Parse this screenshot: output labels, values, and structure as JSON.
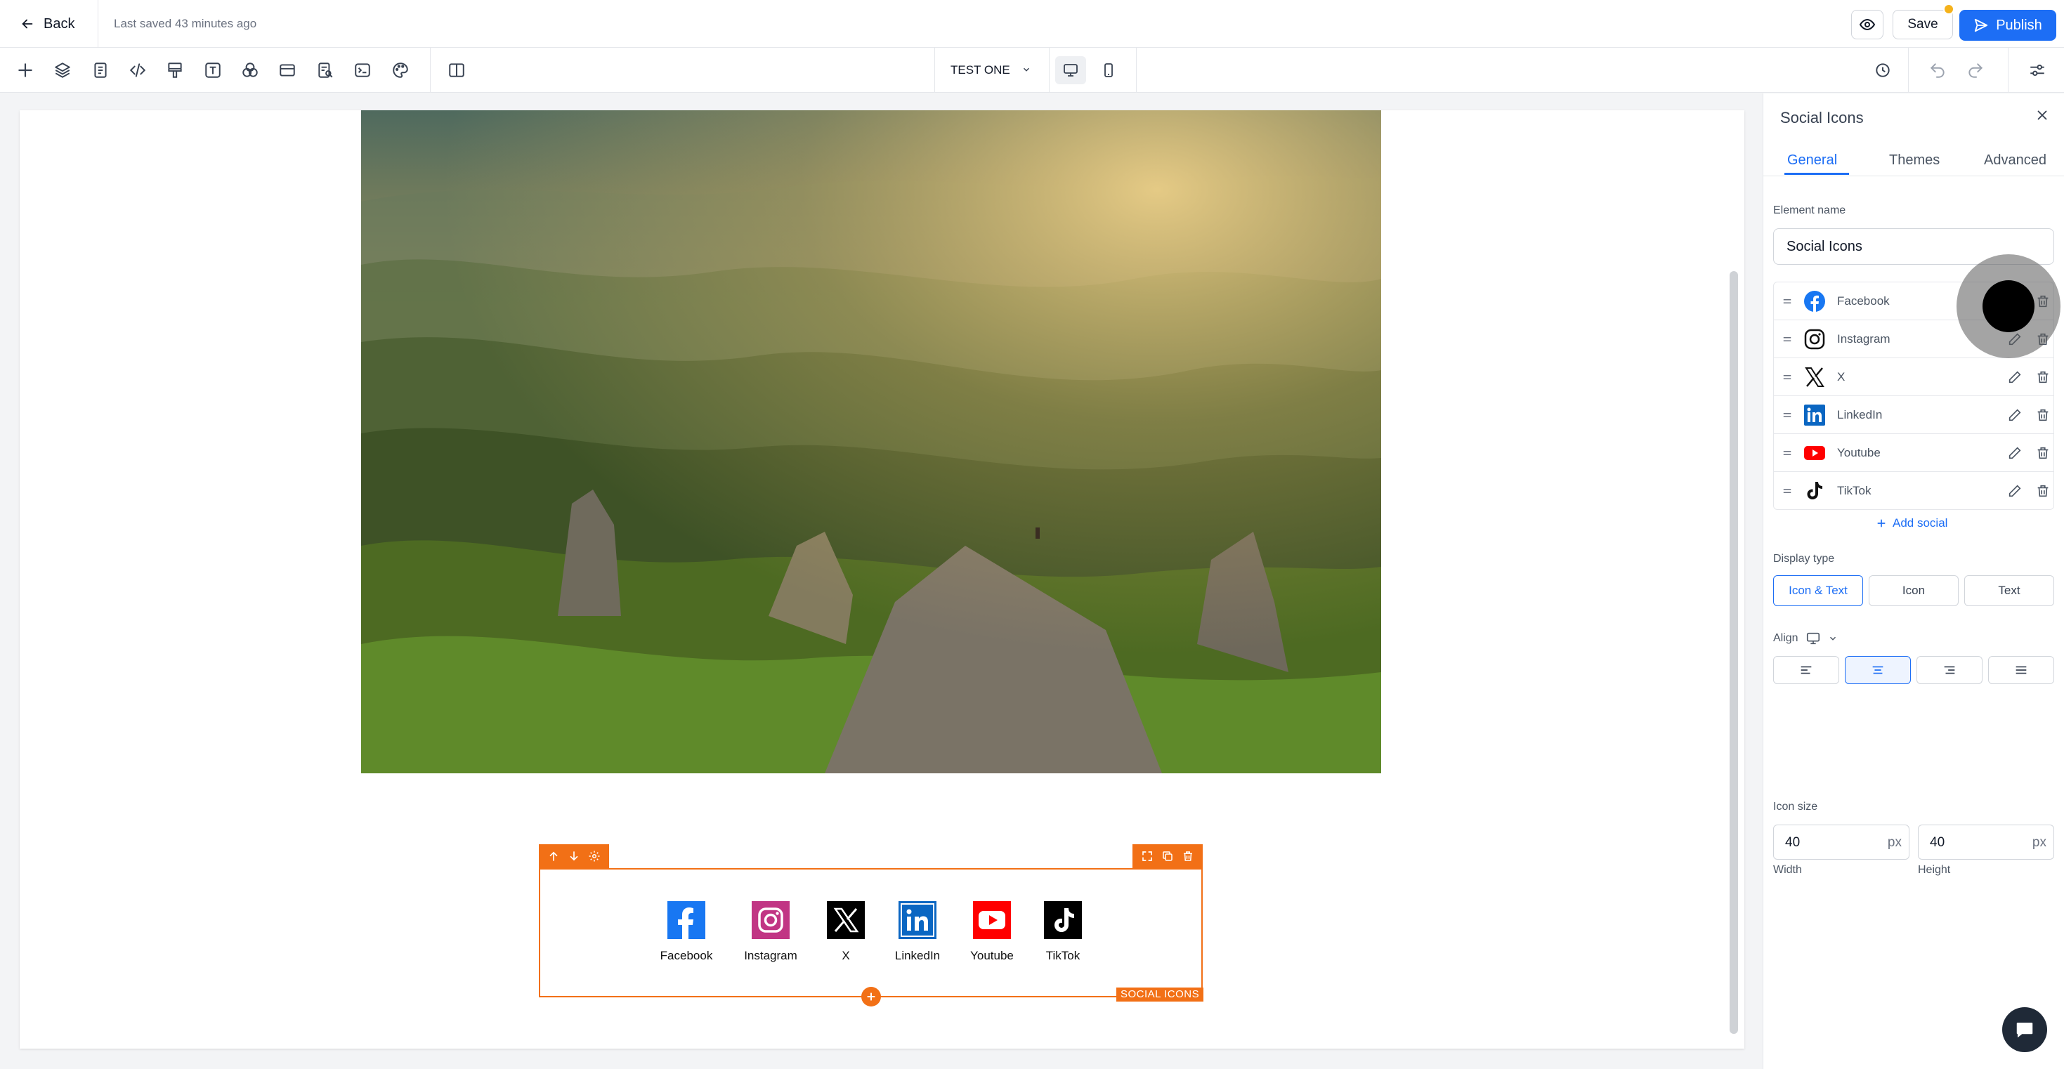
{
  "header": {
    "back_label": "Back",
    "saved_status": "Last saved 43 minutes ago",
    "save_label": "Save",
    "publish_label": "Publish"
  },
  "toolbar": {
    "tools": [
      "plus-icon",
      "layers-icon",
      "pages-icon",
      "code-icon",
      "brush-icon",
      "text-icon",
      "shapes-icon",
      "layout-icon",
      "search-doc-icon",
      "terminal-icon",
      "palette-icon",
      "split-view-icon"
    ],
    "page_name": "TEST ONE",
    "devices": [
      "desktop-icon",
      "mobile-icon"
    ],
    "active_device": "desktop",
    "right_tools": [
      "history-icon",
      "undo-icon",
      "redo-icon",
      "settings-sliders-icon"
    ]
  },
  "canvas": {
    "block_label": "SOCIAL ICONS",
    "socials": [
      {
        "name": "Facebook",
        "color": "#1877f2"
      },
      {
        "name": "Instagram",
        "color": "#c13584"
      },
      {
        "name": "X",
        "color": "#000000"
      },
      {
        "name": "LinkedIn",
        "color": "#0a66c2"
      },
      {
        "name": "Youtube",
        "color": "#ff0000"
      },
      {
        "name": "TikTok",
        "color": "#000000"
      }
    ]
  },
  "panel": {
    "title": "Social Icons",
    "tabs": [
      "General",
      "Themes",
      "Advanced"
    ],
    "active_tab": "General",
    "element_name_label": "Element name",
    "element_name_value": "Social Icons",
    "social_list": [
      "Facebook",
      "Instagram",
      "X",
      "LinkedIn",
      "Youtube",
      "TikTok"
    ],
    "add_social_label": "Add social",
    "display_type_label": "Display type",
    "display_types": [
      "Icon & Text",
      "Icon",
      "Text"
    ],
    "active_display_type": "Icon & Text",
    "align_label": "Align",
    "active_align": "center",
    "icon_size_label": "Icon size",
    "width_value": "40",
    "height_value": "40",
    "unit": "px",
    "width_label": "Width",
    "height_label": "Height"
  },
  "colors": {
    "accent": "#1d6ef5",
    "selection": "#f27016"
  }
}
